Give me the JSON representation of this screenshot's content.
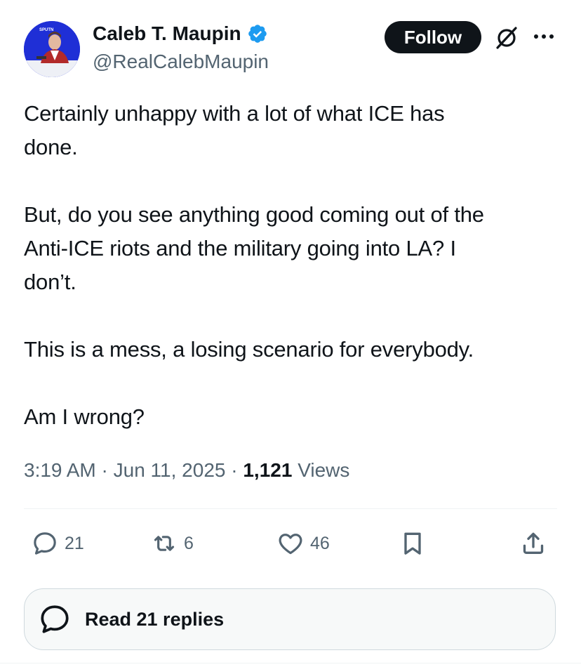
{
  "author": {
    "name": "Caleb T. Maupin",
    "handle": "@RealCalebMaupin",
    "verified": true,
    "avatar_caption": "SPUTN"
  },
  "header": {
    "follow_label": "Follow",
    "grok_icon": "grok-icon",
    "more_icon": "more-icon"
  },
  "tweet": {
    "text": "Certainly unhappy with a lot of what ICE has\ndone.\n\nBut, do you see anything good coming out of the\nAnti-ICE riots and the military going into LA? I\ndon’t.\n\nThis is a mess, a losing scenario for everybody.\n\n Am I wrong?",
    "time": "3:19 AM",
    "date": "Jun 11, 2025",
    "views_count": "1,121",
    "views_label": "Views"
  },
  "actions": {
    "replies": "21",
    "reposts": "6",
    "likes": "46"
  },
  "read_replies_label": "Read 21 replies",
  "colors": {
    "text": "#0f1419",
    "secondary": "#536471",
    "verified": "#1d9bf0",
    "button_dark": "#0f1419"
  }
}
